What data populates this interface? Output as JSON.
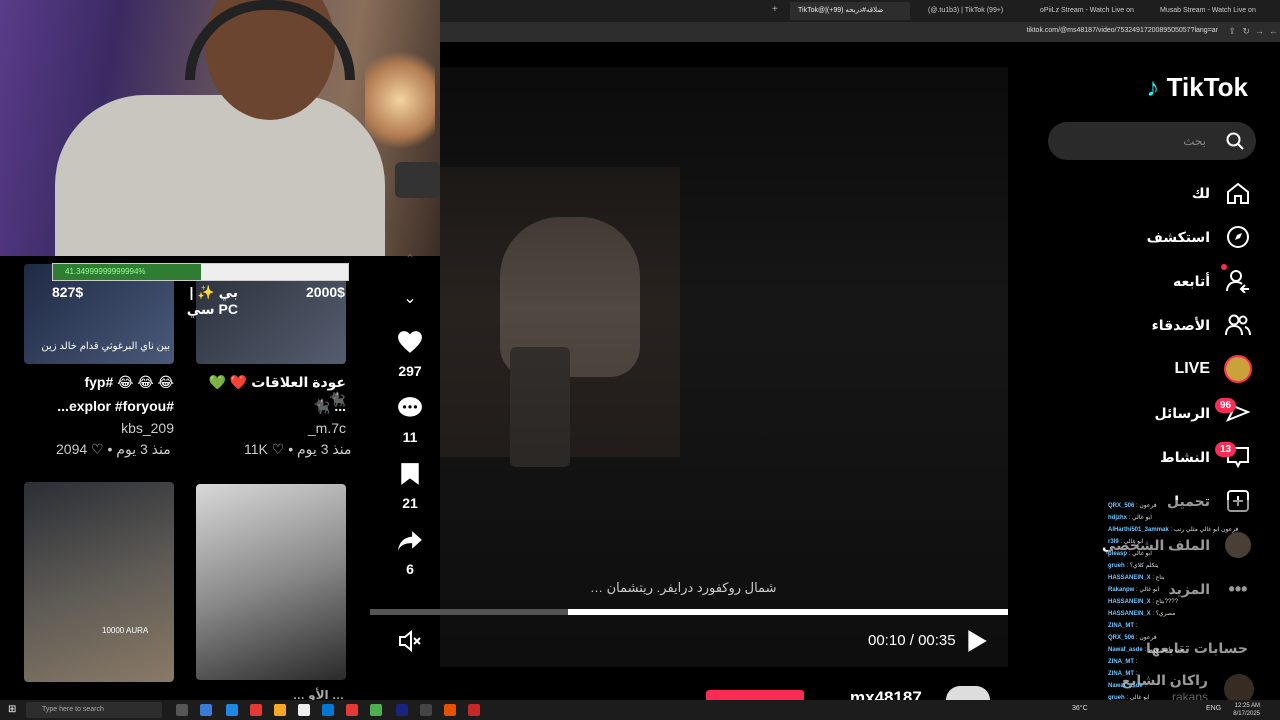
{
  "browser": {
    "tabs": [
      {
        "label": "⁦TikTok@|ضلاقه#دربحه (99+)"
      },
      {
        "label": "(@.tu1b3) | TikTok (99+)"
      },
      {
        "label": "oPiiLz Stream - Watch Live on"
      },
      {
        "label": "Musab Stream - Watch Live on"
      }
    ],
    "url": "tiktok.com/@ms48187/video/7532491720089505057?lang=ar"
  },
  "feed": {
    "progress_text": "41.34999999999994%",
    "progress_fraction": 0.5,
    "cards": [
      {
        "price": "827$",
        "caption_line1": "😂 😂 😂 #fyp",
        "caption_line2": "#explor #foryou...",
        "author": "kbs_209",
        "likes": "2094",
        "age": "منذ 3 يوم",
        "overlay": "بين ناي البرغوثي قدام خالد زين"
      },
      {
        "price": "2000$",
        "title": "بي ✨ | PC سي",
        "caption_line1": "عودة العلاقات ❤️ 💚 🐈‍⬛",
        "caption_line2": "... 🐈‍⬛",
        "author": "m.7c_",
        "likes": "11K",
        "age": "منذ 3 يوم"
      }
    ],
    "thumb_text": "10000 AURA",
    "bottom_caption": "… الأو …"
  },
  "video": {
    "subtitle": "شمال روكفورد درايفر. ريتشمان …",
    "time_current": "00:10",
    "time_total": "00:35",
    "progress_fraction": 0.31,
    "author": "mx48187"
  },
  "actions": {
    "likes": "297",
    "comments": "11",
    "saves": "21",
    "shares": "6"
  },
  "sidebar": {
    "logo": "TikTok",
    "search_placeholder": "بحث",
    "nav": [
      {
        "label": "لك"
      },
      {
        "label": "استكشف"
      },
      {
        "label": "أتابعه"
      },
      {
        "label": "الأصدقاء"
      },
      {
        "label": "LIVE"
      },
      {
        "label": "الرسائل",
        "badge": "96"
      },
      {
        "label": "النشاط",
        "badge": "13"
      },
      {
        "label": "تحميل"
      },
      {
        "label": "الملف الشخصي"
      },
      {
        "label": "المزيد"
      }
    ],
    "following_title": "حسابات تتابعها",
    "following_user": "راكان الشايع",
    "following_handle": "rakans"
  },
  "chat": [
    {
      "user": "QRX_506",
      "msg": "فرعون"
    },
    {
      "user": "hdjzhx",
      "msg": "ابو غالي"
    },
    {
      "user": "AlHarthi501_3ammak",
      "msg": "فرعون ابو غالي مثلي رتب"
    },
    {
      "user": "r3l9",
      "msg": "ابو غالي"
    },
    {
      "user": "pleasp",
      "msg": "ابو غالي"
    },
    {
      "user": "grueh",
      "msg": "يتكلم كلاي؟"
    },
    {
      "user": "HASSANEIN_X",
      "msg": "بتاع"
    },
    {
      "user": "Rakanpw",
      "msg": "ابو غالي"
    },
    {
      "user": "HASSANEIN_X",
      "msg": "بتاع????"
    },
    {
      "user": "HASSANEIN_X",
      "msg": "مصري؟"
    },
    {
      "user": "ZINA_MT",
      "msg": ""
    },
    {
      "user": "QRX_506",
      "msg": "فرعون"
    },
    {
      "user": "Nawaf_asde",
      "msg": "متى راتبي وزير"
    },
    {
      "user": "ZINA_MT",
      "msg": ""
    },
    {
      "user": "ZINA_MT",
      "msg": ""
    },
    {
      "user": "Nawaf_asde",
      "msg": ""
    },
    {
      "user": "grueh",
      "msg": "ابو غالي"
    }
  ],
  "taskbar": {
    "search_placeholder": "Type here to search",
    "temperature": "36°C",
    "lang": "ENG",
    "time": "12:25 AM",
    "date": "8/17/2025"
  },
  "colors": {
    "accent": "#fe2c55",
    "bg": "#000000"
  }
}
